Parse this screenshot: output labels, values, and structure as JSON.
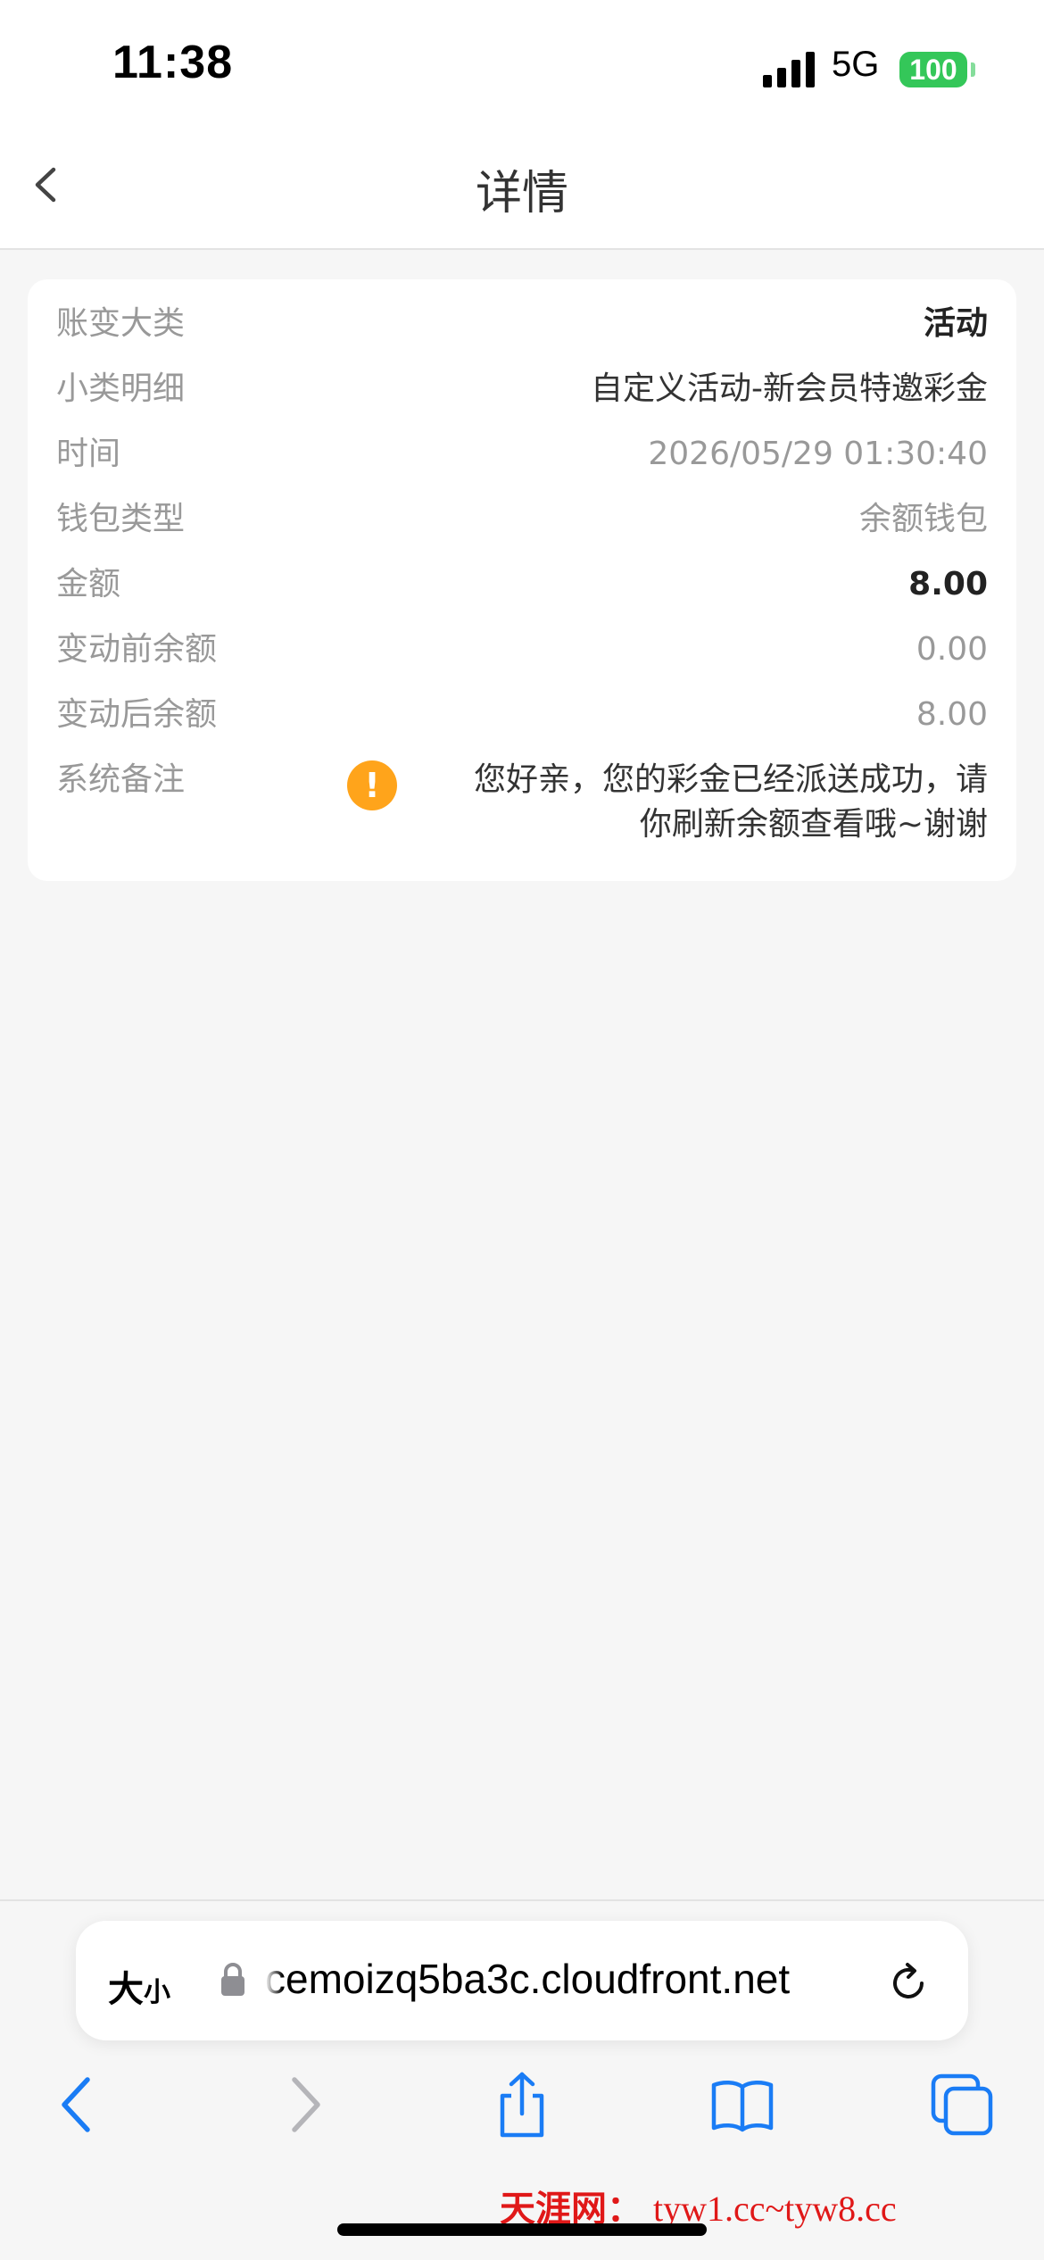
{
  "status_bar": {
    "time": "11:38",
    "network": "5G",
    "battery": "100"
  },
  "nav": {
    "title": "详情"
  },
  "details": {
    "rows": [
      {
        "label": "账变大类",
        "value": "活动"
      },
      {
        "label": "小类明细",
        "value": "自定义活动-新会员特邀彩金"
      },
      {
        "label": "时间",
        "value": "2026/05/29 01:30:40"
      },
      {
        "label": "钱包类型",
        "value": "余额钱包"
      },
      {
        "label": "金额",
        "value": "8.00"
      },
      {
        "label": "变动前余额",
        "value": "0.00"
      },
      {
        "label": "变动后余额",
        "value": "8.00"
      }
    ],
    "note_label": "系统备注",
    "note_line1": "您好亲，您的彩金已经派送成功，请",
    "note_line2": "你刷新余额查看哦~谢谢"
  },
  "browser": {
    "text_size_big": "大",
    "text_size_small": "小",
    "url": "cemoizq5ba3c.cloudfront.net"
  },
  "watermark": {
    "brand": "天涯网：",
    "urls": "tyw1.cc~tyw8.cc"
  },
  "icons": {
    "back": "chevron-left-icon",
    "lock": "lock-icon",
    "reload": "reload-icon",
    "share": "share-icon",
    "bookmarks": "book-icon",
    "tabs": "tabs-icon",
    "warning": "exclamation-icon"
  },
  "colors": {
    "accent": "#1a7cf5",
    "warning": "#ffa41b",
    "battery": "#34c759"
  }
}
